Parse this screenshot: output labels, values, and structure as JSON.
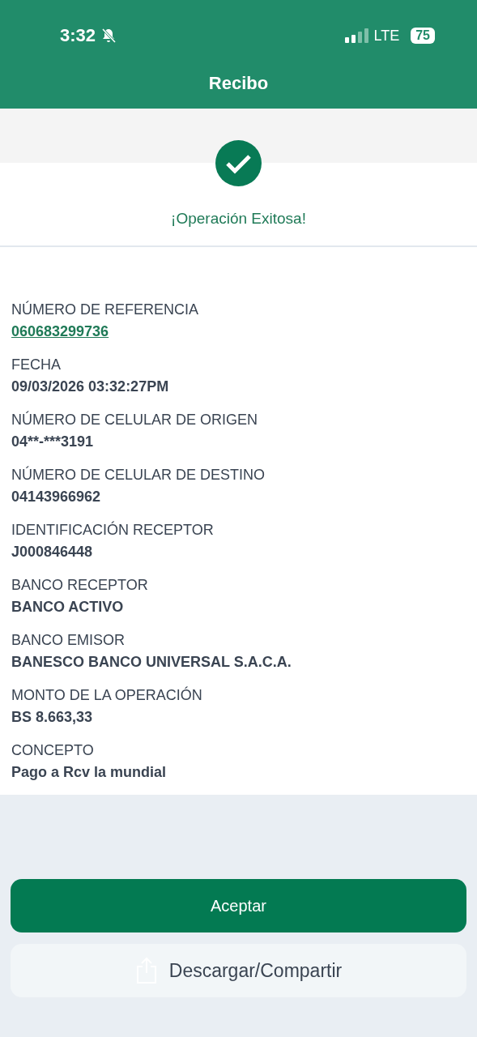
{
  "status_bar": {
    "time": "3:32",
    "network": "LTE",
    "battery": "75"
  },
  "header": {
    "title": "Recibo"
  },
  "result": {
    "message": "¡Operación Exitosa!"
  },
  "fields": [
    {
      "label": "NÚMERO DE REFERENCIA",
      "value": "060683299736",
      "kind": "link"
    },
    {
      "label": "FECHA",
      "value": "09/03/2026 03:32:27PM",
      "kind": "text"
    },
    {
      "label": "NÚMERO DE CELULAR DE ORIGEN",
      "value": "04**-***3191",
      "kind": "text"
    },
    {
      "label": "NÚMERO DE CELULAR DE DESTINO",
      "value": "04143966962",
      "kind": "text"
    },
    {
      "label": "IDENTIFICACIÓN RECEPTOR",
      "value": "J000846448",
      "kind": "text"
    },
    {
      "label": "BANCO RECEPTOR",
      "value": "BANCO ACTIVO",
      "kind": "text"
    },
    {
      "label": "BANCO EMISOR",
      "value": "BANESCO BANCO UNIVERSAL S.A.C.A.",
      "kind": "text"
    },
    {
      "label": "MONTO DE LA OPERACIÓN",
      "value": "BS 8.663,33",
      "kind": "text"
    },
    {
      "label": "CONCEPTO",
      "value": "Pago a Rcv la mundial",
      "kind": "text"
    }
  ],
  "buttons": [
    {
      "label": "Aceptar",
      "kind": "primary"
    },
    {
      "label": "Descargar/Compartir",
      "kind": "share"
    }
  ]
}
